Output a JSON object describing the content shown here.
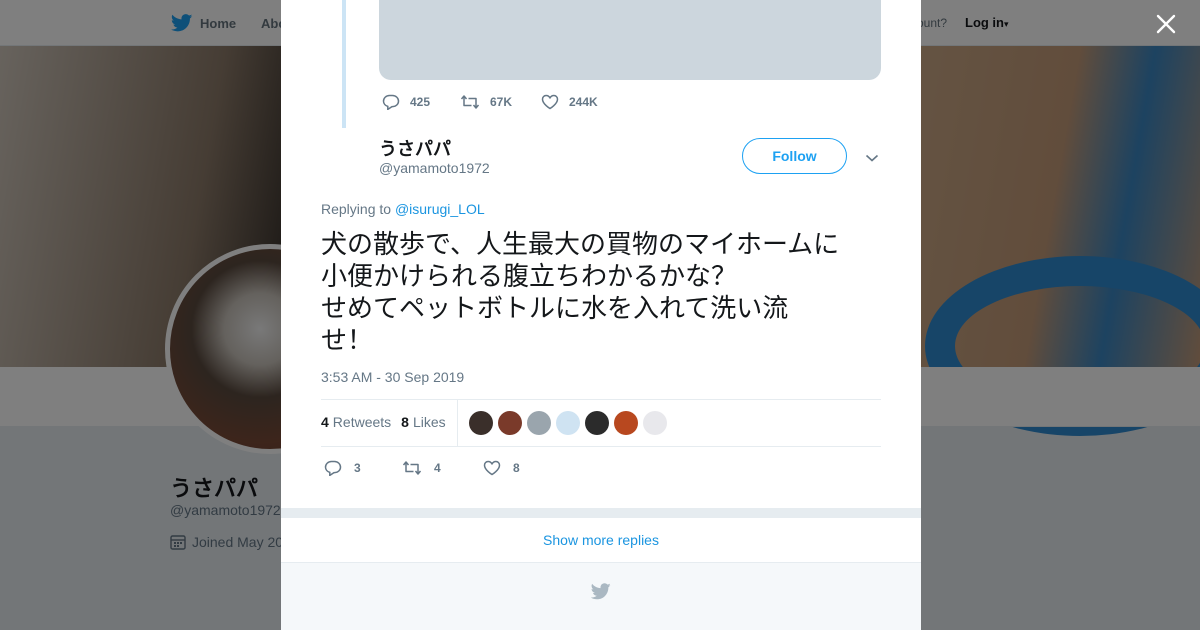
{
  "background": {
    "nav": {
      "home_label": "Home",
      "about_label": "Abo",
      "account_prompt": "ccount?",
      "login_label": "Log in"
    },
    "profile": {
      "name": "うさパパ",
      "handle": "@yamamoto1972",
      "joined": "Joined May 20"
    }
  },
  "parent_tweet": {
    "replies": "425",
    "retweets": "67K",
    "likes": "244K"
  },
  "tweet": {
    "author_name": "うさパパ",
    "author_handle": "@yamamoto1972",
    "follow_label": "Follow",
    "replying_prefix": "Replying to",
    "replying_to": "@isurugi_LOL",
    "text": "犬の散歩で、人生最大の買物のマイホームに\n小便かけられる腹立ちわかるかな？\nせめてペットボトルに水を入れて洗い流\nせ！",
    "timestamp": "3:53 AM - 30 Sep 2019",
    "retweet_count": "4",
    "retweets_word": "Retweets",
    "like_count": "8",
    "likes_word": "Likes",
    "likers": [
      {
        "color": "#3a2f2a"
      },
      {
        "color": "#7a3a2a"
      },
      {
        "color": "#9aa5ad"
      },
      {
        "color": "#cfe3f2"
      },
      {
        "color": "#2b2b2b"
      },
      {
        "color": "#b8481f"
      },
      {
        "color": "#e8e8ec"
      }
    ],
    "action_replies": "3",
    "action_retweets": "4",
    "action_likes": "8"
  },
  "show_more_label": "Show more replies",
  "colors": {
    "accent": "#1da1f2",
    "link": "#1b95e0",
    "muted": "#657786"
  }
}
